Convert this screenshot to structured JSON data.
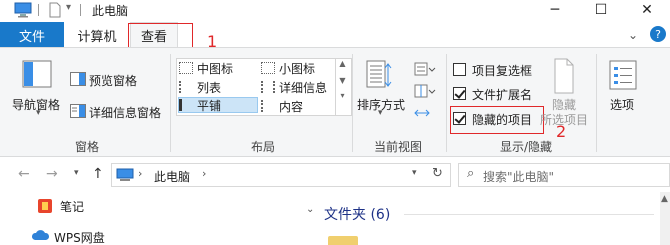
{
  "window": {
    "title": "此电脑",
    "minimize_glyph": "─",
    "maximize_glyph": "☐",
    "close_glyph": "✕",
    "help_glyph": "?",
    "ribbon_collapse_glyph": "⌄"
  },
  "tabs": [
    {
      "label": "文件",
      "active": false
    },
    {
      "label": "计算机",
      "active": false
    },
    {
      "label": "查看",
      "active": true
    }
  ],
  "annotations": {
    "one": "1",
    "two": "2"
  },
  "ribbon": {
    "panes": {
      "label": "窗格",
      "nav_pane": "导航窗格",
      "preview_pane": "预览窗格",
      "details_pane": "详细信息窗格"
    },
    "layout": {
      "label": "布局",
      "items": [
        "中图标",
        "小图标",
        "列表",
        "详细信息",
        "平铺",
        "内容"
      ],
      "selected": "平铺"
    },
    "current_view": {
      "label": "当前视图",
      "sort_by": "排序方式"
    },
    "show_hide": {
      "label": "显示/隐藏",
      "item_checkboxes": {
        "label": "项目复选框",
        "checked": false
      },
      "file_extensions": {
        "label": "文件扩展名",
        "checked": true
      },
      "hidden_items": {
        "label": "隐藏的项目",
        "checked": true
      },
      "hide_selected_1": "隐藏",
      "hide_selected_2": "所选项目"
    },
    "options": {
      "label": "选项"
    }
  },
  "address": {
    "path": "此电脑",
    "search_placeholder": "搜索\"此电脑\""
  },
  "sidebar": [
    {
      "label": "笔记",
      "icon": "note-icon"
    },
    {
      "label": "WPS网盘",
      "icon": "cloud-icon"
    }
  ],
  "content": {
    "folders_header": "文件夹 (6)"
  },
  "colors": {
    "file_tab": "#1979ca",
    "annotation": "#e0282a",
    "ribbon_bg": "#f5f6f7",
    "selection": "#cce4f7"
  }
}
